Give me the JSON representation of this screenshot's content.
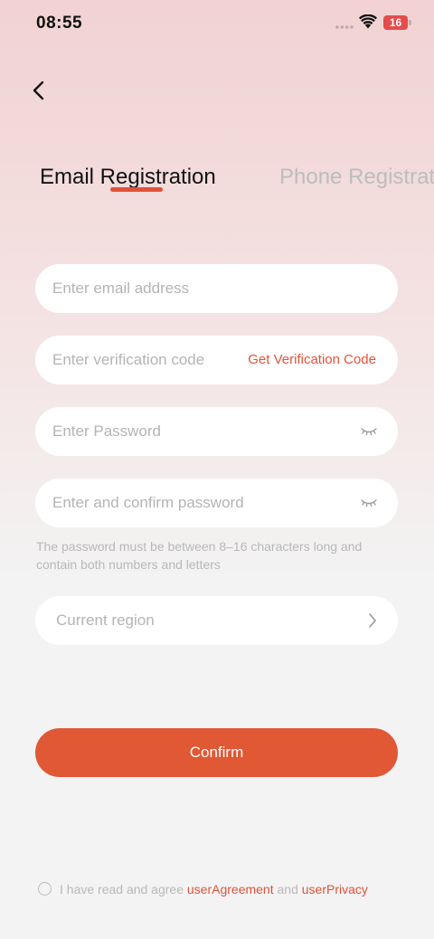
{
  "status_bar": {
    "time": "08:55",
    "battery_level": "16"
  },
  "tabs": {
    "email_label": "Email Registration",
    "phone_label": "Phone Registration",
    "active": "email"
  },
  "form": {
    "email_placeholder": "Enter email address",
    "code_placeholder": "Enter verification code",
    "get_code_label": "Get Verification Code",
    "password_placeholder": "Enter Password",
    "confirm_placeholder": "Enter and confirm password",
    "password_hint": "The password must be between 8–16 characters long and contain both numbers and letters",
    "region_placeholder": "Current region"
  },
  "confirm_label": "Confirm",
  "agreement": {
    "prefix": "I have read and agree ",
    "user_agreement": "userAgreement",
    "conjunction": " and ",
    "user_privacy": "userPrivacy",
    "checked": false
  },
  "colors": {
    "accent": "#e05834",
    "link": "#e0533a",
    "placeholder": "#b4b4b4"
  },
  "icons": [
    "back-chevron-icon",
    "wifi-icon",
    "battery-icon",
    "eye-closed-icon",
    "chevron-right-icon",
    "radio-circle-icon"
  ]
}
